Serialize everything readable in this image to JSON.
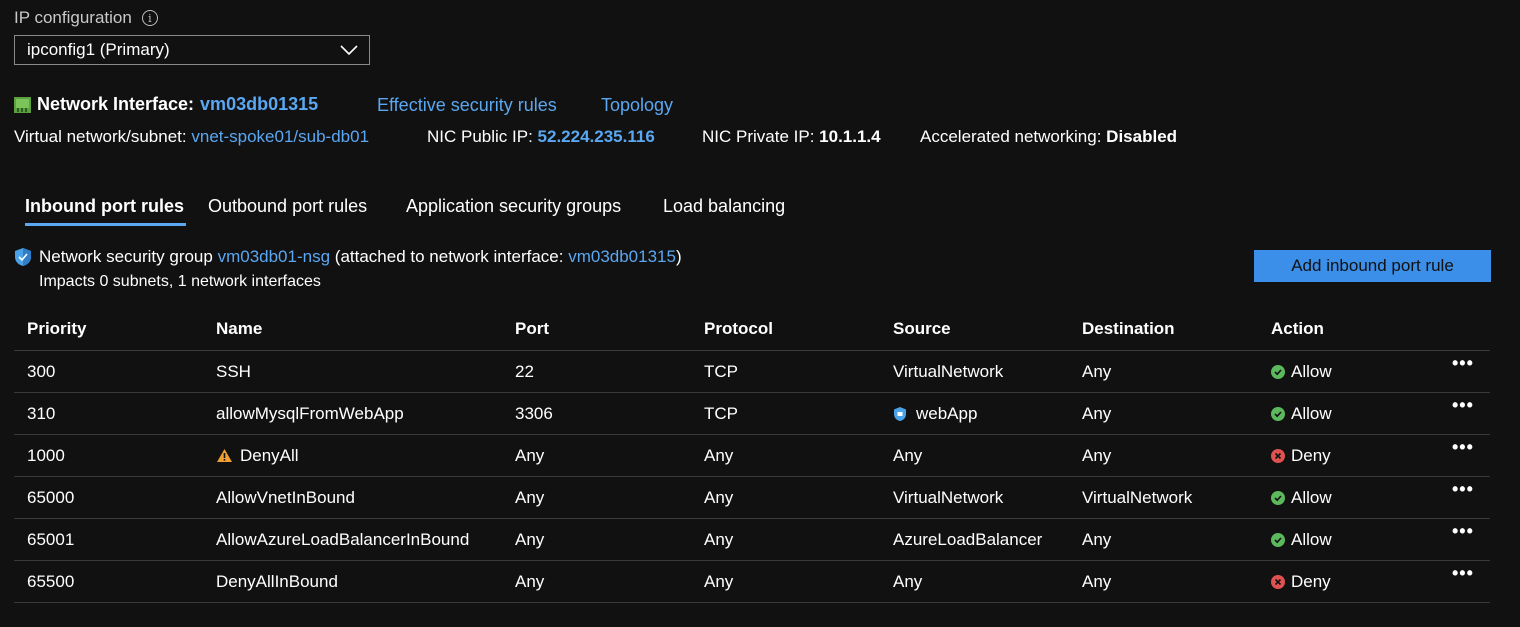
{
  "ip_config": {
    "label": "IP configuration",
    "info_glyph": "i",
    "selected": "ipconfig1 (Primary)"
  },
  "nic": {
    "label": "Network Interface:",
    "name": "vm03db01315",
    "effective_rules_link": "Effective security rules",
    "topology_link": "Topology",
    "vnet_label": "Virtual network/subnet:",
    "vnet_value": "vnet-spoke01/sub-db01",
    "public_ip_label": "NIC Public IP:",
    "public_ip_value": "52.224.235.116",
    "private_ip_label": "NIC Private IP:",
    "private_ip_value": "10.1.1.4",
    "accel_label": "Accelerated networking:",
    "accel_value": "Disabled"
  },
  "tabs": [
    {
      "label": "Inbound port rules",
      "active": true
    },
    {
      "label": "Outbound port rules",
      "active": false
    },
    {
      "label": "Application security groups",
      "active": false
    },
    {
      "label": "Load balancing",
      "active": false
    }
  ],
  "nsg": {
    "prefix": "Network security group",
    "name": "vm03db01-nsg",
    "attached_text": "(attached to network interface:",
    "attached_nic": "vm03db01315",
    "close_paren": ")",
    "impacts": "Impacts 0 subnets, 1 network interfaces",
    "add_button": "Add inbound port rule"
  },
  "table": {
    "headers": [
      "Priority",
      "Name",
      "Port",
      "Protocol",
      "Source",
      "Destination",
      "Action"
    ],
    "more_glyph": "•••",
    "rows": [
      {
        "priority": "300",
        "name": "SSH",
        "port": "22",
        "protocol": "TCP",
        "source": "VirtualNetwork",
        "destination": "Any",
        "action": "Allow"
      },
      {
        "priority": "310",
        "name": "allowMysqlFromWebApp",
        "port": "3306",
        "protocol": "TCP",
        "source": "webApp",
        "destination": "Any",
        "action": "Allow"
      },
      {
        "priority": "1000",
        "name": "DenyAll",
        "port": "Any",
        "protocol": "Any",
        "source": "Any",
        "destination": "Any",
        "action": "Deny"
      },
      {
        "priority": "65000",
        "name": "AllowVnetInBound",
        "port": "Any",
        "protocol": "Any",
        "source": "VirtualNetwork",
        "destination": "VirtualNetwork",
        "action": "Allow"
      },
      {
        "priority": "65001",
        "name": "AllowAzureLoadBalancerInBound",
        "port": "Any",
        "protocol": "Any",
        "source": "AzureLoadBalancer",
        "destination": "Any",
        "action": "Allow"
      },
      {
        "priority": "65500",
        "name": "DenyAllInBound",
        "port": "Any",
        "protocol": "Any",
        "source": "Any",
        "destination": "Any",
        "action": "Deny"
      }
    ]
  },
  "colors": {
    "background": "#111111",
    "link": "#5aa7f2",
    "allow": "#5cb85c",
    "deny": "#e05252",
    "warning": "#f0a030",
    "button": "#3b8fe8"
  },
  "icons": {
    "info": "info-icon",
    "dropdown": "chevron-down-icon",
    "nic": "network-interface-icon",
    "nsg": "shield-icon",
    "warning": "warning-icon",
    "asg": "application-security-group-icon",
    "allow": "check-circle-icon",
    "deny": "x-circle-icon",
    "more": "more-icon"
  }
}
